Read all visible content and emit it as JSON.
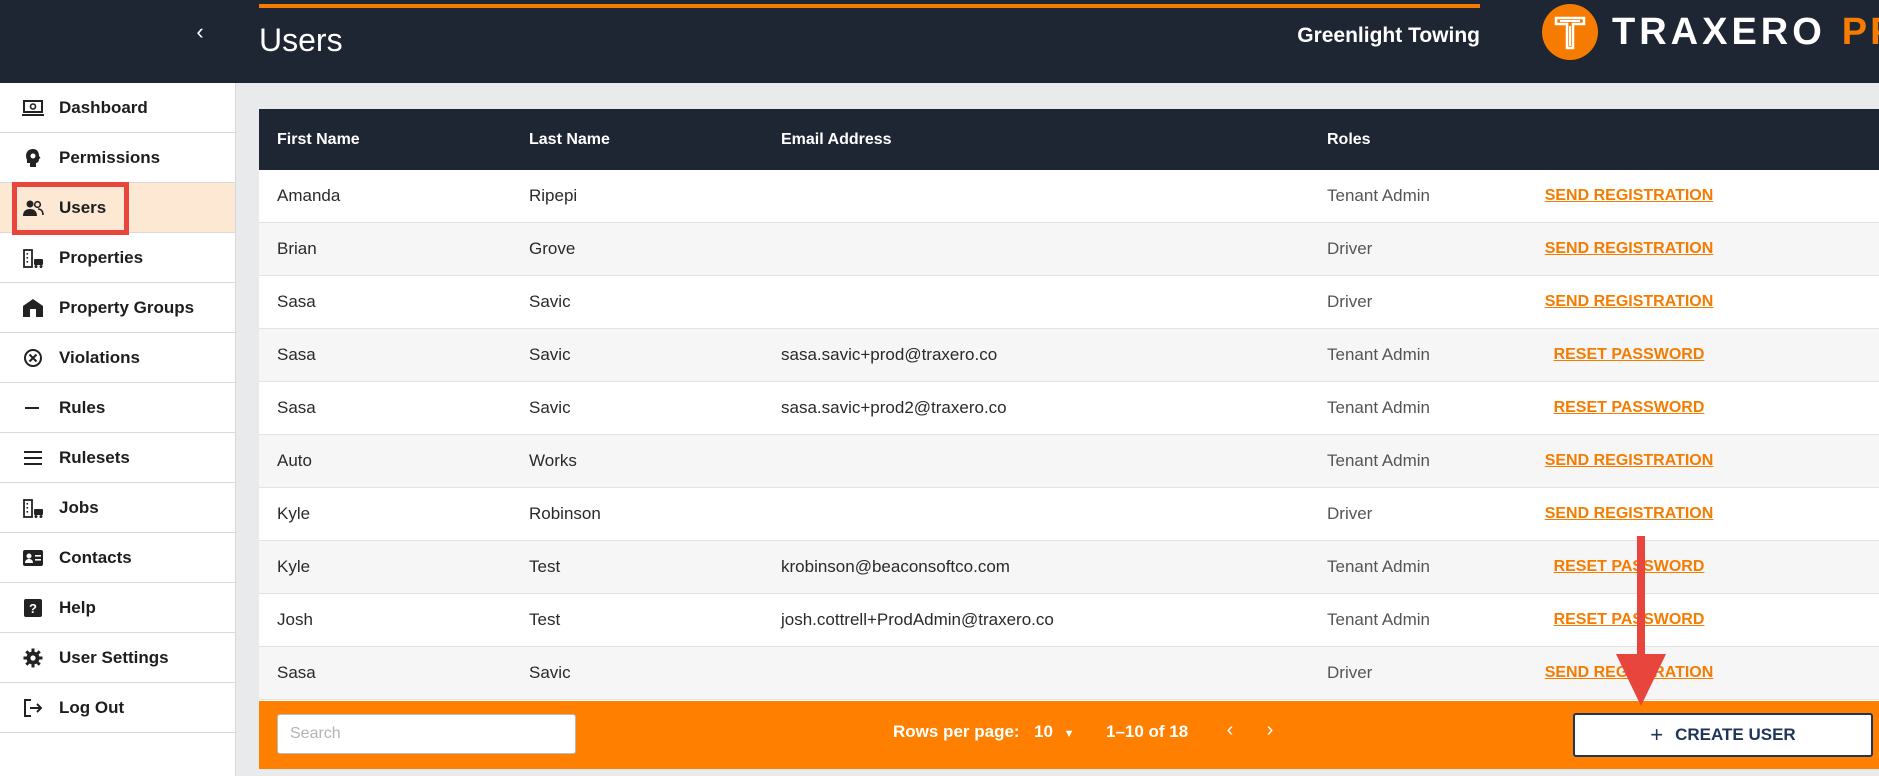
{
  "header": {
    "title": "Users",
    "company": "Greenlight Towing",
    "logo_text": "TRAXERO",
    "logo_suffix": "PPI",
    "collapse_icon": "chevron-left-icon"
  },
  "sidebar": {
    "items": [
      {
        "label": "Dashboard",
        "icon": "dashboard-icon"
      },
      {
        "label": "Permissions",
        "icon": "permissions-icon"
      },
      {
        "label": "Users",
        "icon": "users-icon",
        "active": true
      },
      {
        "label": "Properties",
        "icon": "properties-icon"
      },
      {
        "label": "Property Groups",
        "icon": "property-groups-icon"
      },
      {
        "label": "Violations",
        "icon": "violations-icon"
      },
      {
        "label": "Rules",
        "icon": "rules-icon"
      },
      {
        "label": "Rulesets",
        "icon": "rulesets-icon"
      },
      {
        "label": "Jobs",
        "icon": "jobs-icon"
      },
      {
        "label": "Contacts",
        "icon": "contacts-icon"
      },
      {
        "label": "Help",
        "icon": "help-icon"
      },
      {
        "label": "User Settings",
        "icon": "gear-icon"
      },
      {
        "label": "Log Out",
        "icon": "logout-icon"
      }
    ]
  },
  "table": {
    "columns": [
      "First Name",
      "Last Name",
      "Email Address",
      "Roles"
    ],
    "rows": [
      {
        "first": "Amanda",
        "last": "Ripepi",
        "email": "",
        "role": "Tenant Admin",
        "action": "SEND REGISTRATION"
      },
      {
        "first": "Brian",
        "last": "Grove",
        "email": "",
        "role": "Driver",
        "action": "SEND REGISTRATION"
      },
      {
        "first": "Sasa",
        "last": "Savic",
        "email": "",
        "role": "Driver",
        "action": "SEND REGISTRATION"
      },
      {
        "first": "Sasa",
        "last": "Savic",
        "email": "sasa.savic+prod@traxero.co",
        "role": "Tenant Admin",
        "action": "RESET PASSWORD"
      },
      {
        "first": "Sasa",
        "last": "Savic",
        "email": "sasa.savic+prod2@traxero.co",
        "role": "Tenant Admin",
        "action": "RESET PASSWORD"
      },
      {
        "first": "Auto",
        "last": "Works",
        "email": "",
        "role": "Tenant Admin",
        "action": "SEND REGISTRATION"
      },
      {
        "first": "Kyle",
        "last": "Robinson",
        "email": "",
        "role": "Driver",
        "action": "SEND REGISTRATION"
      },
      {
        "first": "Kyle",
        "last": "Test",
        "email": "krobinson@beaconsoftco.com",
        "role": "Tenant Admin",
        "action": "RESET PASSWORD"
      },
      {
        "first": "Josh",
        "last": "Test",
        "email": "josh.cottrell+ProdAdmin@traxero.co",
        "role": "Tenant Admin",
        "action": "RESET PASSWORD"
      },
      {
        "first": "Sasa",
        "last": "Savic",
        "email": "",
        "role": "Driver",
        "action": "SEND REGISTRATION"
      }
    ]
  },
  "footer": {
    "search_placeholder": "Search",
    "rows_per_page_label": "Rows per page:",
    "rows_per_page_value": "10",
    "range": "1–10 of 18",
    "create_user_label": "CREATE USER"
  },
  "colors": {
    "header_bg": "#1e2533",
    "accent": "#f57c00",
    "footer_bg": "#ff8000",
    "annotation": "#e8453c"
  }
}
